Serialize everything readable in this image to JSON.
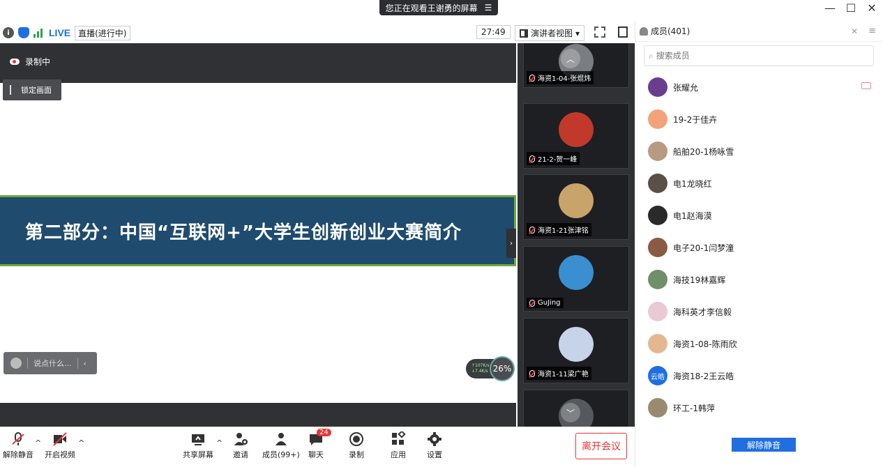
{
  "top_banner": {
    "sharing_text": "您正在观看王谢勇的屏幕",
    "menu_glyph": "☰"
  },
  "window_controls": {
    "minimize": "—",
    "maximize": "☐",
    "close": "✕"
  },
  "info_bar": {
    "live_badge": "LIVE",
    "live_status": "直播(进行中)",
    "timer": "27:49",
    "view_mode": "演讲者视图",
    "view_mode_arrow": "▾"
  },
  "stage": {
    "recording_label": "录制中",
    "lock_view_label": "锁定画面",
    "slide_title": "第二部分：中国“互联网+”大学生创新创业大赛简介",
    "comment_placeholder": "说点什么...",
    "comment_collapse": "‹",
    "net_up": "↑107K/s",
    "net_down": "↓7.4K/s",
    "cpu_usage": "26%",
    "collapse_handle": "›"
  },
  "video_strip": {
    "scroll_up": "︿",
    "scroll_down": "﹀",
    "tiles": [
      {
        "name": "海资1-04-张焜炜",
        "avatar_color": "#7a7d82"
      },
      {
        "name": "21-2-贺一峰",
        "avatar_color": "#c0392b"
      },
      {
        "name": "海资1-21张津铭",
        "avatar_color": "#c9a46a"
      },
      {
        "name": "GuJing",
        "avatar_color": "#3a8fd0"
      },
      {
        "name": "海资1-11梁广艳",
        "avatar_color": "#c7d3e8"
      }
    ]
  },
  "members_panel": {
    "title": "成员(401)",
    "search_placeholder": "搜索成员",
    "members": [
      {
        "name": "张耀允",
        "avatar_color": "#6a3d8f",
        "avatar_text": ""
      },
      {
        "name": "19-2于佳卉",
        "avatar_color": "#f2a37a",
        "avatar_text": ""
      },
      {
        "name": "船舶20-1杨咏雪",
        "avatar_color": "#b89a80",
        "avatar_text": ""
      },
      {
        "name": "电1龙晓红",
        "avatar_color": "#5a5048",
        "avatar_text": ""
      },
      {
        "name": "电1赵海漠",
        "avatar_color": "#2a2a2a",
        "avatar_text": ""
      },
      {
        "name": "电子20-1闫梦潼",
        "avatar_color": "#8a5a44",
        "avatar_text": ""
      },
      {
        "name": "海技19林嘉辉",
        "avatar_color": "#6e8f6a",
        "avatar_text": ""
      },
      {
        "name": "海科英才李信毅",
        "avatar_color": "#e8c9d4",
        "avatar_text": ""
      },
      {
        "name": "海资1-08-陈雨欣",
        "avatar_color": "#e3b890",
        "avatar_text": ""
      },
      {
        "name": "海资18-2王云皓",
        "avatar_color": "#1f6fe0",
        "avatar_text": "云皓"
      },
      {
        "name": "环工-1韩萍",
        "avatar_color": "#9a8a70",
        "avatar_text": ""
      }
    ],
    "unmute_all": "解除静音"
  },
  "toolbar": {
    "unmute": "解除静音",
    "start_video": "开启视频",
    "share_screen": "共享屏幕",
    "invite": "邀请",
    "members": "成员(99+)",
    "chat": "聊天",
    "chat_badge": "24",
    "record": "录制",
    "apps": "应用",
    "settings": "设置",
    "leave": "离开会议",
    "caret": "^"
  },
  "colors": {
    "accent": "#1f6fe0",
    "danger": "#e33333",
    "slide_bg": "#1f4b6e",
    "slide_border": "#6aaa3a"
  }
}
